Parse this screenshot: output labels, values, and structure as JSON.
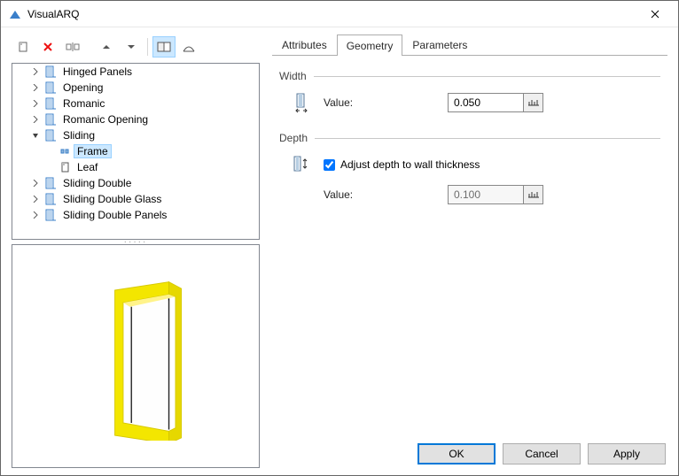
{
  "window": {
    "title": "VisualARQ"
  },
  "toolbar": {
    "icons": {
      "new_style": "new-style-icon",
      "delete": "delete-icon",
      "rename": "rename-icon",
      "move_up": "chevron-up-icon",
      "move_down": "chevron-down-icon",
      "preview_mode": "preview-mode-icon",
      "section_mode": "section-mode-icon"
    }
  },
  "tree": {
    "items": [
      {
        "label": "Hinged Panels",
        "depth": 1,
        "twisty": "closed",
        "icon": "door-style-icon"
      },
      {
        "label": "Opening",
        "depth": 1,
        "twisty": "closed",
        "icon": "door-style-icon"
      },
      {
        "label": "Romanic",
        "depth": 1,
        "twisty": "closed",
        "icon": "door-style-icon"
      },
      {
        "label": "Romanic Opening",
        "depth": 1,
        "twisty": "closed",
        "icon": "door-style-icon"
      },
      {
        "label": "Sliding",
        "depth": 1,
        "twisty": "open",
        "icon": "door-style-icon"
      },
      {
        "label": "Frame",
        "depth": 2,
        "twisty": "none",
        "icon": "frame-icon",
        "selected": true
      },
      {
        "label": "Leaf",
        "depth": 2,
        "twisty": "none",
        "icon": "leaf-icon"
      },
      {
        "label": "Sliding Double",
        "depth": 1,
        "twisty": "closed",
        "icon": "door-style-icon"
      },
      {
        "label": "Sliding Double Glass",
        "depth": 1,
        "twisty": "closed",
        "icon": "door-style-icon"
      },
      {
        "label": "Sliding Double Panels",
        "depth": 1,
        "twisty": "closed",
        "icon": "door-style-icon"
      }
    ],
    "indent": 16
  },
  "tabs": {
    "items": [
      {
        "label": "Attributes",
        "active": false
      },
      {
        "label": "Geometry",
        "active": true
      },
      {
        "label": "Parameters",
        "active": false
      }
    ]
  },
  "geometry": {
    "width": {
      "heading": "Width",
      "value_label": "Value:",
      "value": "0.050",
      "icon": "width-icon"
    },
    "depth": {
      "heading": "Depth",
      "adjust_label": "Adjust depth to wall thickness",
      "adjust_checked": true,
      "value_label": "Value:",
      "value": "0.100",
      "icon": "depth-icon"
    }
  },
  "buttons": {
    "ok": "OK",
    "cancel": "Cancel",
    "apply": "Apply"
  }
}
